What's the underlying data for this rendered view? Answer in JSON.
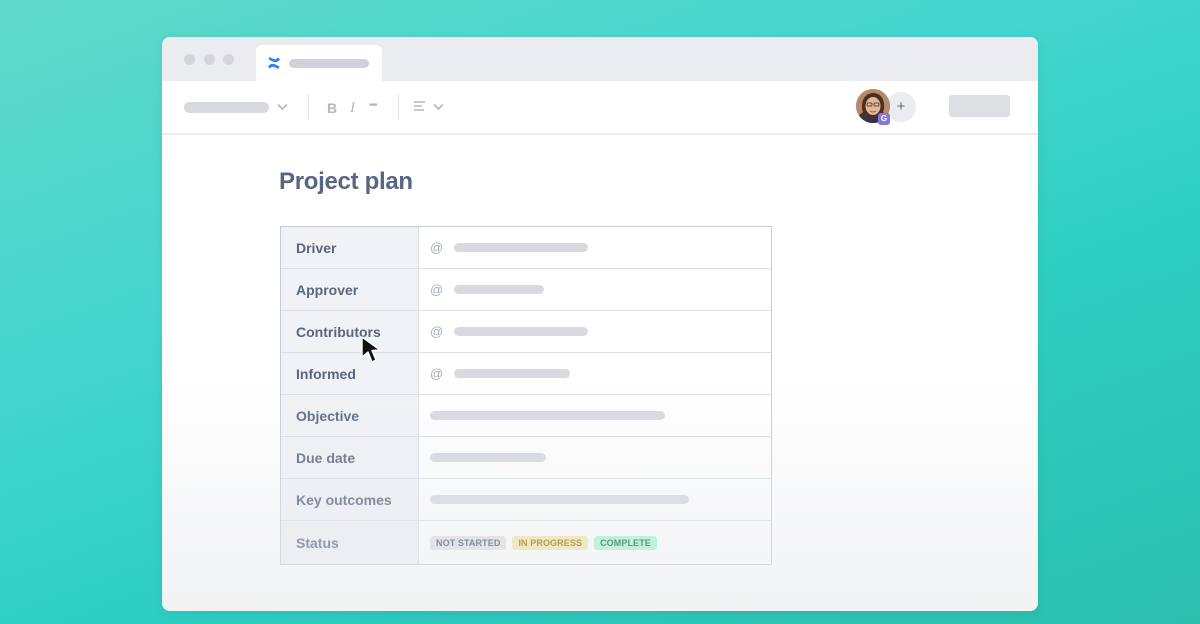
{
  "window": {
    "traffic_lights": [
      "close",
      "minimize",
      "maximize"
    ]
  },
  "tab": {
    "icon": "confluence-icon"
  },
  "toolbar": {
    "bold_label": "B",
    "italic_label": "I",
    "more_label": "•••",
    "align_label": "≡",
    "add_user_label": "+",
    "avatar_badge": "G"
  },
  "page": {
    "title": "Project plan"
  },
  "table": {
    "rows": [
      {
        "label": "Driver"
      },
      {
        "label": "Approver"
      },
      {
        "label": "Contributors"
      },
      {
        "label": "Informed"
      },
      {
        "label": "Objective"
      },
      {
        "label": "Due date"
      },
      {
        "label": "Key outcomes"
      },
      {
        "label": "Status"
      }
    ],
    "mention_symbol": "@",
    "status_options": [
      {
        "label": "NOT STARTED",
        "bg": "#dfe1e6",
        "fg": "#42526e"
      },
      {
        "label": "IN PROGRESS",
        "bg": "#f6e8a8",
        "fg": "#8a6d00"
      },
      {
        "label": "COMPLETE",
        "bg": "#abf5d1",
        "fg": "#006644"
      }
    ]
  },
  "colors": {
    "background_start": "#5fd8c8",
    "background_end": "#2bbfae",
    "title_text": "#596681",
    "accent": "#2684ff"
  }
}
